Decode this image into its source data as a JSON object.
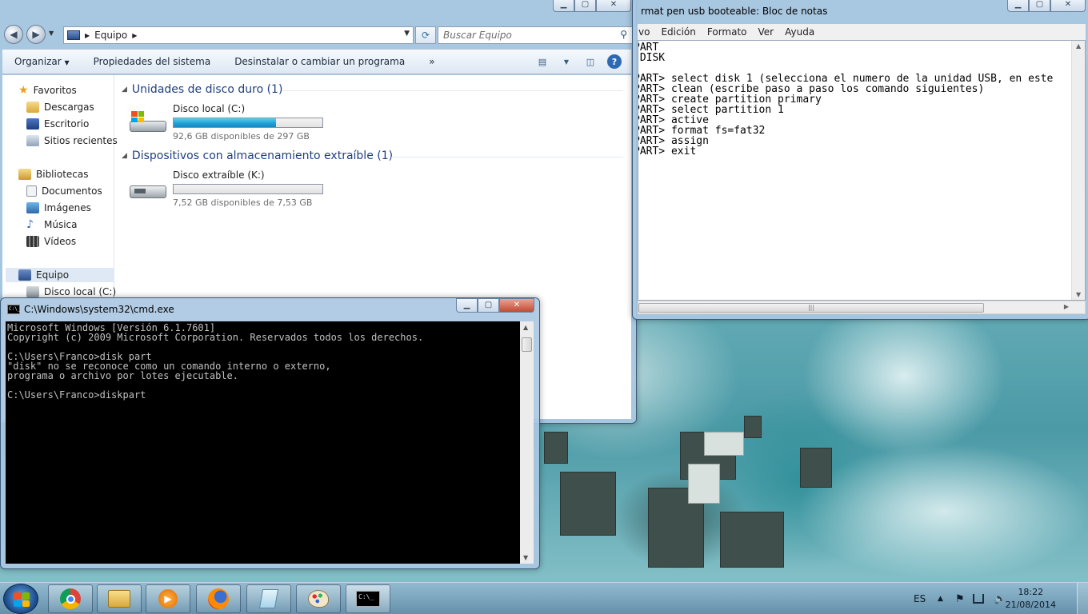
{
  "explorer": {
    "breadcrumb": "Equipo",
    "search_placeholder": "Buscar Equipo",
    "toolbar": {
      "organize": "Organizar",
      "properties": "Propiedades del sistema",
      "uninstall": "Desinstalar o cambiar un programa",
      "more": "»"
    },
    "nav": {
      "favorites": "Favoritos",
      "downloads": "Descargas",
      "desktop": "Escritorio",
      "recent": "Sitios recientes",
      "libraries": "Bibliotecas",
      "documents": "Documentos",
      "images": "Imágenes",
      "music": "Música",
      "videos": "Vídeos",
      "computer": "Equipo",
      "local_disk": "Disco local (C:)"
    },
    "groups": {
      "hard_drives": "Unidades de disco duro (1)",
      "removable": "Dispositivos con almacenamiento extraíble (1)"
    },
    "drives": [
      {
        "name": "Disco local (C:)",
        "info": "92,6 GB disponibles de 297 GB",
        "used_fraction": 0.69
      },
      {
        "name": "Disco extraíble (K:)",
        "info": "7,52 GB disponibles de 7,53 GB",
        "used_fraction": 0.0
      }
    ]
  },
  "notepad": {
    "title": "rmat pen usb booteable: Bloc de notas",
    "menu": [
      "vo",
      "Edición",
      "Formato",
      "Ver",
      "Ayuda"
    ],
    "content": "PART\n DISK\n\nPART> select disk 1 (selecciona el numero de la unidad USB, en este\nPART> clean (escribe paso a paso los comando siguientes)\nPART> create partition primary\nPART> select partition 1\nPART> active\nPART> format fs=fat32\nPART> assign\nPART> exit"
  },
  "cmd": {
    "title": "C:\\Windows\\system32\\cmd.exe",
    "icon_text": "C:\\_",
    "content": "Microsoft Windows [Versión 6.1.7601]\nCopyright (c) 2009 Microsoft Corporation. Reservados todos los derechos.\n\nC:\\Users\\Franco>disk part\n\"disk\" no se reconoce como un comando interno o externo,\nprograma o archivo por lotes ejecutable.\n\nC:\\Users\\Franco>diskpart"
  },
  "taskbar": {
    "language": "ES",
    "time": "18:22",
    "date": "21/08/2014",
    "apps": [
      "chrome-icon",
      "explorer-icon",
      "media-player-icon",
      "firefox-icon",
      "notepad-icon",
      "paint-icon",
      "cmd-icon"
    ]
  },
  "colors": {
    "progress_fill": "#1ea2d8",
    "group_header": "#1e3f80",
    "close_button": "#c24a32"
  }
}
